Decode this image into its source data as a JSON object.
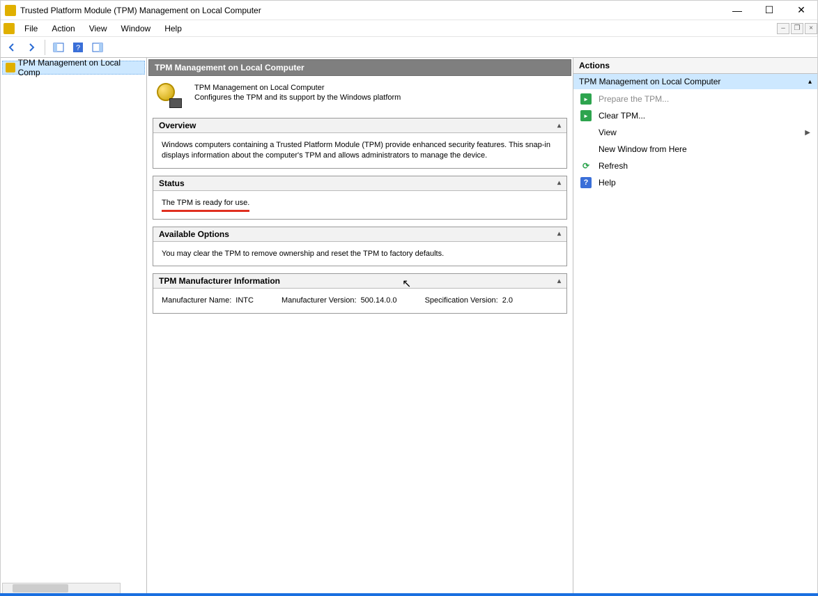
{
  "window": {
    "title": "Trusted Platform Module (TPM) Management on Local Computer"
  },
  "menubar": {
    "file": "File",
    "action": "Action",
    "view": "View",
    "window": "Window",
    "help": "Help"
  },
  "tree": {
    "node0": "TPM Management on Local Comp"
  },
  "center": {
    "header": "TPM Management on Local Computer",
    "intro_title": "TPM Management on Local Computer",
    "intro_sub": "Configures the TPM and its support by the Windows platform",
    "overview": {
      "title": "Overview",
      "text": "Windows computers containing a Trusted Platform Module (TPM) provide enhanced security features. This snap-in displays information about the computer's TPM and allows administrators to manage the device."
    },
    "status": {
      "title": "Status",
      "text": "The TPM is ready for use."
    },
    "options": {
      "title": "Available Options",
      "text": "You may clear the TPM to remove ownership and reset the TPM to factory defaults."
    },
    "mfr": {
      "title": "TPM Manufacturer Information",
      "name_label": "Manufacturer Name:",
      "name_value": "INTC",
      "ver_label": "Manufacturer Version:",
      "ver_value": "500.14.0.0",
      "spec_label": "Specification Version:",
      "spec_value": "2.0"
    }
  },
  "actions": {
    "title": "Actions",
    "group": "TPM Management on Local Computer",
    "prepare": "Prepare the TPM...",
    "clear": "Clear TPM...",
    "view": "View",
    "new_window": "New Window from Here",
    "refresh": "Refresh",
    "help": "Help"
  }
}
